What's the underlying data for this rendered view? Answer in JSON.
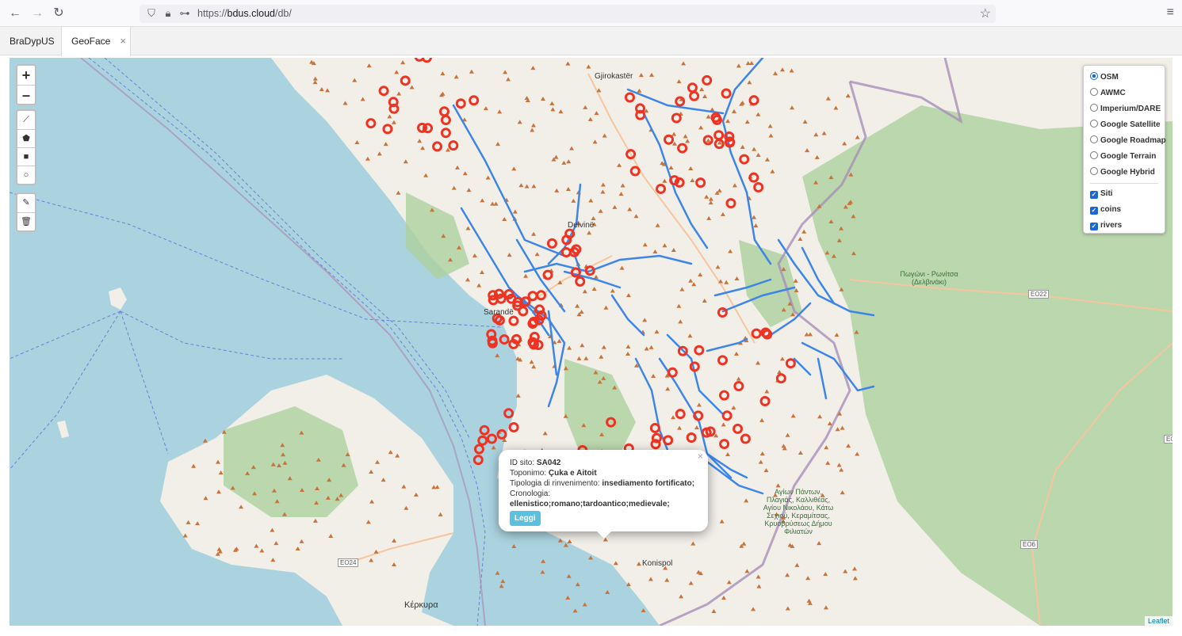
{
  "browser": {
    "url_prefix": "https://",
    "url_domain": "bdus.cloud",
    "url_path": "/db/"
  },
  "app": {
    "tabs": [
      {
        "label": "BraDypUS"
      },
      {
        "label": "GeoFace",
        "close": "×"
      }
    ]
  },
  "map": {
    "zoom_in": "+",
    "zoom_out": "–",
    "layers": {
      "base": [
        {
          "label": "OSM",
          "selected": true
        },
        {
          "label": "AWMC",
          "selected": false
        },
        {
          "label": "Imperium/DARE",
          "selected": false
        },
        {
          "label": "Google Satellite",
          "selected": false
        },
        {
          "label": "Google Roadmap",
          "selected": false
        },
        {
          "label": "Google Terrain",
          "selected": false
        },
        {
          "label": "Google Hybrid",
          "selected": false
        }
      ],
      "overlays": [
        {
          "label": "Siti",
          "checked": true
        },
        {
          "label": "coins",
          "checked": true
        },
        {
          "label": "rivers",
          "checked": true
        }
      ]
    },
    "labels": {
      "gjirokaster": "Gjirokastër",
      "delvine": "Delvinë",
      "sarande": "Sarandë",
      "konispol": "Konispol",
      "kerkyra": "Κέρκυρα",
      "pogoni": "Πωγώνι - Ρωνίτσα (Δελβινάκι)",
      "filiates": "Αγίων Πάντων, Πλαγιάς, Καλλιθέας, Αγίου Νικολάου, Κάτω Σεχιού, Κεραμίτσας, Κρυοβρύσεως Δήμου Φιλιατών",
      "eo22": "EO22",
      "eo24": "EO24",
      "eo6": "EO6",
      "eo": "EO"
    },
    "popup": {
      "id_label": "ID sito:",
      "id_value": "SA042",
      "toponym_label": "Toponimo:",
      "toponym_value": "Çuka e Aitoit",
      "type_label": "Tipologia di rinvenimento:",
      "type_value": "insediamento fortificato;",
      "chrono_label": "Cronologia:",
      "chrono_value": "ellenistico;romano;tardoantico;medievale;",
      "button": "Leggi",
      "close": "×"
    },
    "attribution": "Leaflet",
    "colors": {
      "sea": "#aad3df",
      "land": "#f2efe9",
      "forest": "#add19e",
      "river": "#3d85e6",
      "site": "#ee3322",
      "coin": "#c8733b"
    }
  }
}
